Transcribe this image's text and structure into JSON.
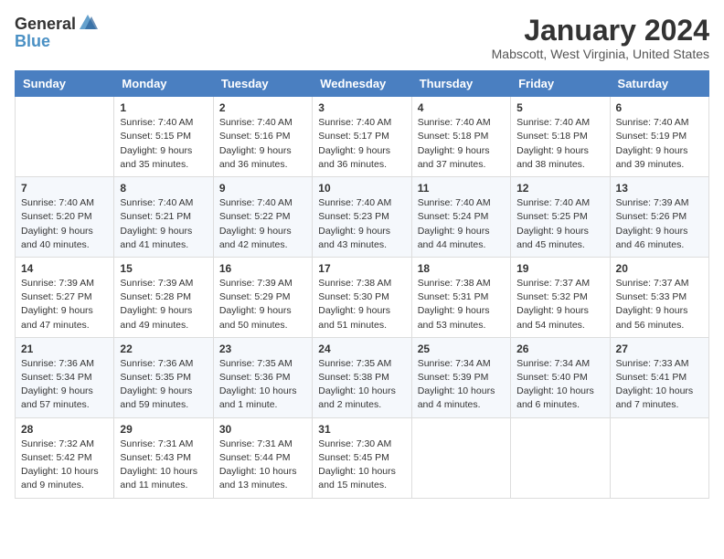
{
  "logo": {
    "general": "General",
    "blue": "Blue"
  },
  "title": "January 2024",
  "location": "Mabscott, West Virginia, United States",
  "days_of_week": [
    "Sunday",
    "Monday",
    "Tuesday",
    "Wednesday",
    "Thursday",
    "Friday",
    "Saturday"
  ],
  "weeks": [
    [
      {
        "day": "",
        "info": ""
      },
      {
        "day": "1",
        "info": "Sunrise: 7:40 AM\nSunset: 5:15 PM\nDaylight: 9 hours\nand 35 minutes."
      },
      {
        "day": "2",
        "info": "Sunrise: 7:40 AM\nSunset: 5:16 PM\nDaylight: 9 hours\nand 36 minutes."
      },
      {
        "day": "3",
        "info": "Sunrise: 7:40 AM\nSunset: 5:17 PM\nDaylight: 9 hours\nand 36 minutes."
      },
      {
        "day": "4",
        "info": "Sunrise: 7:40 AM\nSunset: 5:18 PM\nDaylight: 9 hours\nand 37 minutes."
      },
      {
        "day": "5",
        "info": "Sunrise: 7:40 AM\nSunset: 5:18 PM\nDaylight: 9 hours\nand 38 minutes."
      },
      {
        "day": "6",
        "info": "Sunrise: 7:40 AM\nSunset: 5:19 PM\nDaylight: 9 hours\nand 39 minutes."
      }
    ],
    [
      {
        "day": "7",
        "info": "Sunrise: 7:40 AM\nSunset: 5:20 PM\nDaylight: 9 hours\nand 40 minutes."
      },
      {
        "day": "8",
        "info": "Sunrise: 7:40 AM\nSunset: 5:21 PM\nDaylight: 9 hours\nand 41 minutes."
      },
      {
        "day": "9",
        "info": "Sunrise: 7:40 AM\nSunset: 5:22 PM\nDaylight: 9 hours\nand 42 minutes."
      },
      {
        "day": "10",
        "info": "Sunrise: 7:40 AM\nSunset: 5:23 PM\nDaylight: 9 hours\nand 43 minutes."
      },
      {
        "day": "11",
        "info": "Sunrise: 7:40 AM\nSunset: 5:24 PM\nDaylight: 9 hours\nand 44 minutes."
      },
      {
        "day": "12",
        "info": "Sunrise: 7:40 AM\nSunset: 5:25 PM\nDaylight: 9 hours\nand 45 minutes."
      },
      {
        "day": "13",
        "info": "Sunrise: 7:39 AM\nSunset: 5:26 PM\nDaylight: 9 hours\nand 46 minutes."
      }
    ],
    [
      {
        "day": "14",
        "info": "Sunrise: 7:39 AM\nSunset: 5:27 PM\nDaylight: 9 hours\nand 47 minutes."
      },
      {
        "day": "15",
        "info": "Sunrise: 7:39 AM\nSunset: 5:28 PM\nDaylight: 9 hours\nand 49 minutes."
      },
      {
        "day": "16",
        "info": "Sunrise: 7:39 AM\nSunset: 5:29 PM\nDaylight: 9 hours\nand 50 minutes."
      },
      {
        "day": "17",
        "info": "Sunrise: 7:38 AM\nSunset: 5:30 PM\nDaylight: 9 hours\nand 51 minutes."
      },
      {
        "day": "18",
        "info": "Sunrise: 7:38 AM\nSunset: 5:31 PM\nDaylight: 9 hours\nand 53 minutes."
      },
      {
        "day": "19",
        "info": "Sunrise: 7:37 AM\nSunset: 5:32 PM\nDaylight: 9 hours\nand 54 minutes."
      },
      {
        "day": "20",
        "info": "Sunrise: 7:37 AM\nSunset: 5:33 PM\nDaylight: 9 hours\nand 56 minutes."
      }
    ],
    [
      {
        "day": "21",
        "info": "Sunrise: 7:36 AM\nSunset: 5:34 PM\nDaylight: 9 hours\nand 57 minutes."
      },
      {
        "day": "22",
        "info": "Sunrise: 7:36 AM\nSunset: 5:35 PM\nDaylight: 9 hours\nand 59 minutes."
      },
      {
        "day": "23",
        "info": "Sunrise: 7:35 AM\nSunset: 5:36 PM\nDaylight: 10 hours\nand 1 minute."
      },
      {
        "day": "24",
        "info": "Sunrise: 7:35 AM\nSunset: 5:38 PM\nDaylight: 10 hours\nand 2 minutes."
      },
      {
        "day": "25",
        "info": "Sunrise: 7:34 AM\nSunset: 5:39 PM\nDaylight: 10 hours\nand 4 minutes."
      },
      {
        "day": "26",
        "info": "Sunrise: 7:34 AM\nSunset: 5:40 PM\nDaylight: 10 hours\nand 6 minutes."
      },
      {
        "day": "27",
        "info": "Sunrise: 7:33 AM\nSunset: 5:41 PM\nDaylight: 10 hours\nand 7 minutes."
      }
    ],
    [
      {
        "day": "28",
        "info": "Sunrise: 7:32 AM\nSunset: 5:42 PM\nDaylight: 10 hours\nand 9 minutes."
      },
      {
        "day": "29",
        "info": "Sunrise: 7:31 AM\nSunset: 5:43 PM\nDaylight: 10 hours\nand 11 minutes."
      },
      {
        "day": "30",
        "info": "Sunrise: 7:31 AM\nSunset: 5:44 PM\nDaylight: 10 hours\nand 13 minutes."
      },
      {
        "day": "31",
        "info": "Sunrise: 7:30 AM\nSunset: 5:45 PM\nDaylight: 10 hours\nand 15 minutes."
      },
      {
        "day": "",
        "info": ""
      },
      {
        "day": "",
        "info": ""
      },
      {
        "day": "",
        "info": ""
      }
    ]
  ]
}
